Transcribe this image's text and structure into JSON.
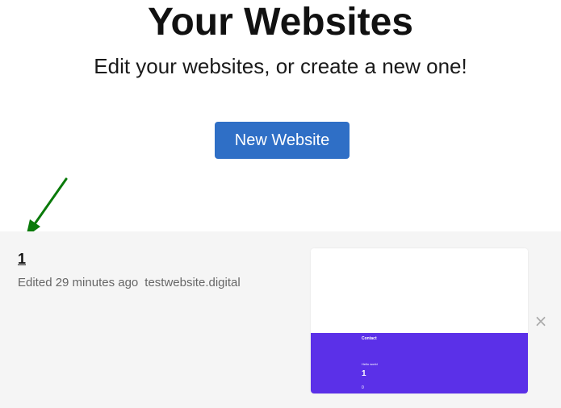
{
  "header": {
    "title": "Your Websites",
    "subtitle": "Edit your websites, or create a new one!"
  },
  "actions": {
    "new_website_label": "New Website"
  },
  "annotation": {
    "arrow_color": "#0a7a0a"
  },
  "websites": [
    {
      "name": "1",
      "edited": "Edited 29 minutes ago",
      "domain": "testwebsite.digital",
      "thumbnail": {
        "nav_label": "Contact",
        "hello_text": "Hello world",
        "heading": "1",
        "small_text": "0",
        "accent_color": "#5b30e8"
      },
      "delete_label": "×"
    }
  ],
  "colors": {
    "primary_button": "#2f6fc6",
    "row_background": "#f5f5f5"
  }
}
